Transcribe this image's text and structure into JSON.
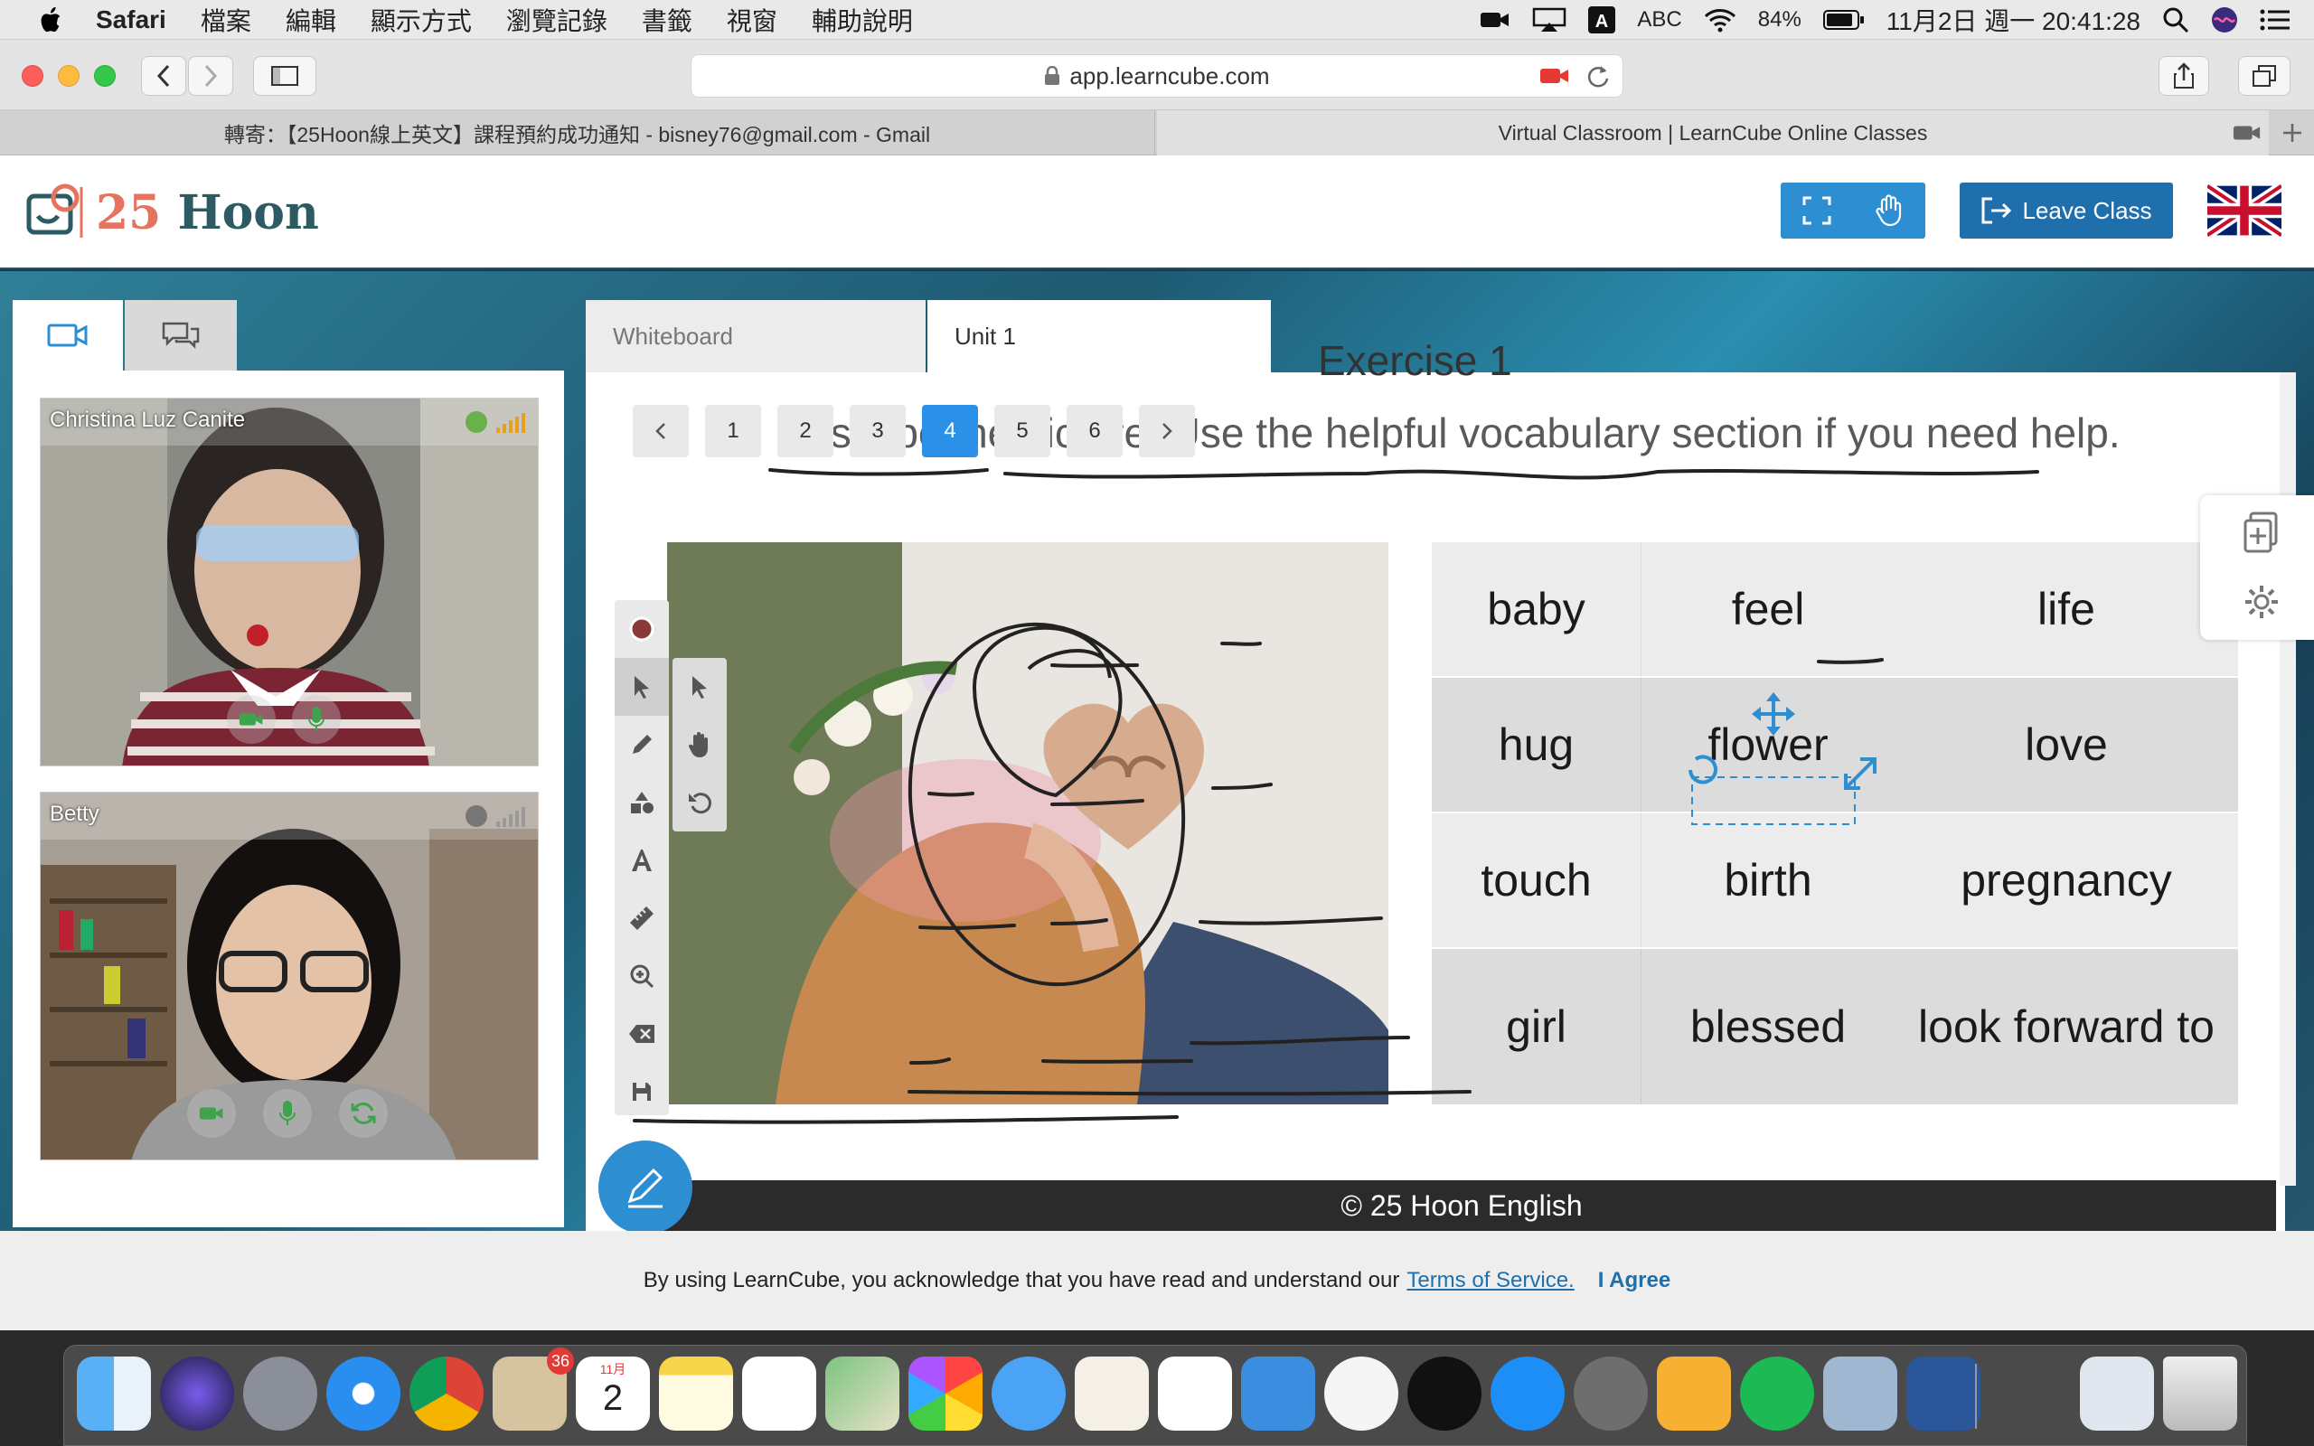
{
  "menubar": {
    "app": "Safari",
    "items": [
      "檔案",
      "編輯",
      "顯示方式",
      "瀏覽記錄",
      "書籤",
      "視窗",
      "輔助說明"
    ],
    "input_source": "ABC",
    "battery": "84%",
    "datetime": "11月2日 週一  20:41:28"
  },
  "browser": {
    "url": "app.learncube.com",
    "tabs": [
      {
        "label": "轉寄：【25Hoon線上英文】課程預約成功通知 - bisney76@gmail.com - Gmail",
        "active": false
      },
      {
        "label": "Virtual Classroom | LearnCube Online Classes",
        "active": true
      }
    ]
  },
  "header": {
    "logo_num": "25",
    "logo_word": "Hoon",
    "leave_label": "Leave Class"
  },
  "participants": [
    {
      "name": "Christina Luz Canite",
      "status_color": "#6ab04c"
    },
    {
      "name": "Betty",
      "status_color": "#777777"
    }
  ],
  "board_tabs": [
    {
      "label": "Whiteboard",
      "active": false
    },
    {
      "label": "Unit 1",
      "active": true
    }
  ],
  "pager": {
    "pages": [
      "1",
      "2",
      "3",
      "4",
      "5",
      "6"
    ],
    "current": "4"
  },
  "slide": {
    "title": "Exercise 1",
    "instruction": "Describe the picture. Use the helpful vocabulary section if you need help.",
    "vocab": [
      [
        "baby",
        "feel",
        "life"
      ],
      [
        "hug",
        "flower",
        "love"
      ],
      [
        "touch",
        "birth",
        "pregnancy"
      ],
      [
        "girl",
        "blessed",
        "look forward to"
      ]
    ],
    "footer": "© 25 Hoon English"
  },
  "cookie": {
    "text": "By using LearnCube, you acknowledge that you have read and understand our",
    "link": "Terms of Service.",
    "agree": "I Agree"
  },
  "dock": {
    "mail_badge": "36",
    "calendar_month": "11月",
    "calendar_day": "2"
  },
  "colors": {
    "accent": "#2d8ed1",
    "leave": "#1f6fad",
    "logo_teal": "#2d5b63",
    "logo_coral": "#e5735f"
  }
}
